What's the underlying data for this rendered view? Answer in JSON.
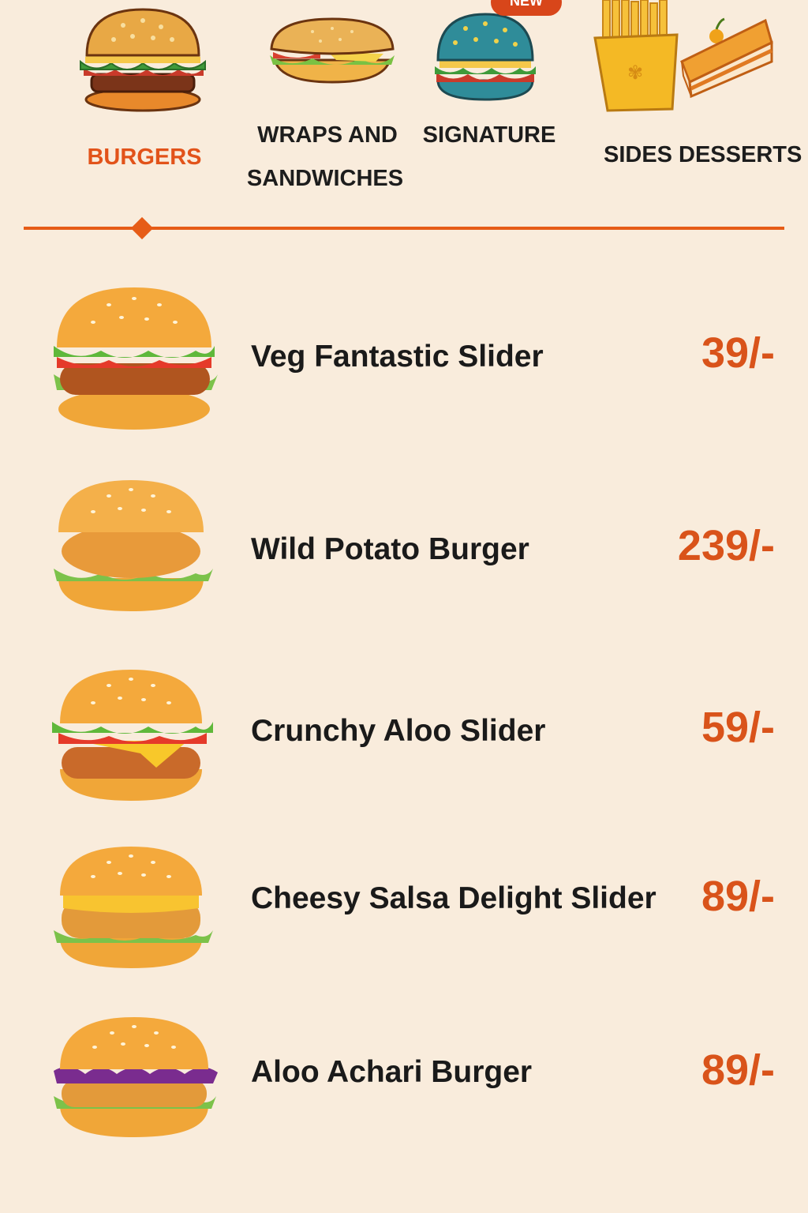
{
  "categories": [
    {
      "id": "burgers",
      "label": "BURGERS",
      "icon": "burger-icon",
      "active": true
    },
    {
      "id": "wraps",
      "label_line1": "WRAPS AND",
      "label_line2": "SANDWICHES",
      "icon": "sandwich-icon",
      "active": false
    },
    {
      "id": "signature",
      "label": "SIGNATURE",
      "icon": "signature-burger-icon",
      "badge": "NEW",
      "active": false
    },
    {
      "id": "sides",
      "label": "SIDES",
      "icon": "fries-icon",
      "active": false
    },
    {
      "id": "desserts",
      "label": "DESSERTS",
      "icon": "cake-icon",
      "active": false
    }
  ],
  "colors": {
    "background": "#f9ecdc",
    "accent": "#e65c17",
    "price": "#d9531a",
    "active_tab": "#e2531a",
    "signature_bun": "#2f8c99"
  },
  "menu": {
    "items": [
      {
        "name": "Veg Fantastic Slider",
        "price": "39/-",
        "icon": "veg-slider-icon"
      },
      {
        "name": "Wild Potato Burger",
        "price": "239/-",
        "icon": "potato-burger-icon"
      },
      {
        "name": "Crunchy Aloo Slider",
        "price": "59/-",
        "icon": "aloo-slider-icon"
      },
      {
        "name": "Cheesy Salsa Delight Slider",
        "price": "89/-",
        "icon": "salsa-slider-icon"
      },
      {
        "name": "Aloo Achari Burger",
        "price": "89/-",
        "icon": "achari-burger-icon"
      }
    ]
  }
}
